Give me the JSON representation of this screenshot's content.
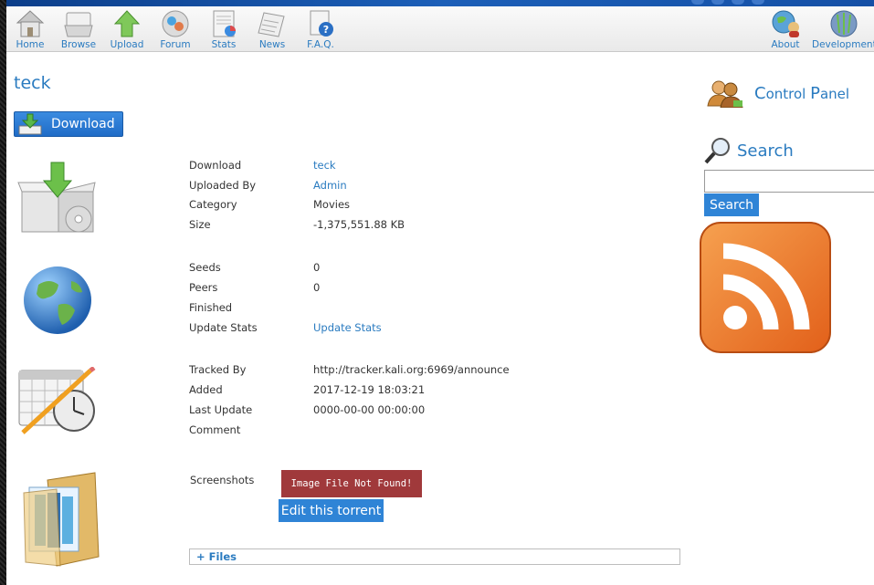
{
  "nav": {
    "left": [
      {
        "label": "Home",
        "icon": "home-icon"
      },
      {
        "label": "Browse",
        "icon": "browse-icon"
      },
      {
        "label": "Upload",
        "icon": "upload-icon"
      },
      {
        "label": "Forum",
        "icon": "forum-icon"
      },
      {
        "label": "Stats",
        "icon": "stats-icon"
      },
      {
        "label": "News",
        "icon": "news-icon"
      },
      {
        "label": "F.A.Q.",
        "icon": "faq-icon"
      }
    ],
    "right": [
      {
        "label": "About",
        "icon": "about-icon"
      },
      {
        "label": "Development",
        "icon": "development-icon"
      }
    ]
  },
  "torrent": {
    "title": "teck",
    "download_button": "Download",
    "info": {
      "download_label": "Download",
      "download_value": "teck",
      "uploaded_by_label": "Uploaded By",
      "uploaded_by_value": "Admin",
      "category_label": "Category",
      "category_value": "Movies",
      "size_label": "Size",
      "size_value": "-1,375,551.88 KB"
    },
    "peers": {
      "seeds_label": "Seeds",
      "seeds_value": "0",
      "peers_label": "Peers",
      "peers_value": "0",
      "finished_label": "Finished",
      "finished_value": "",
      "update_stats_label": "Update Stats",
      "update_stats_value": "Update Stats"
    },
    "tracker": {
      "tracked_by_label": "Tracked By",
      "tracked_by_value": "http://tracker.kali.org:6969/announce",
      "added_label": "Added",
      "added_value": "2017-12-19 18:03:21",
      "last_update_label": "Last Update",
      "last_update_value": "0000-00-00 00:00:00",
      "comment_label": "Comment",
      "comment_value": ""
    },
    "screenshots_label": "Screenshots",
    "image_not_found": "Image File Not Found!",
    "edit_button": "Edit this torrent",
    "files_toggle": "+ Files"
  },
  "sidebar": {
    "control_panel_first": "C",
    "control_panel_rest1": "ontrol ",
    "control_panel_second": "P",
    "control_panel_rest2": "anel",
    "search_title": "Search",
    "search_placeholder": "",
    "search_button": "Search"
  },
  "colors": {
    "link": "#2a7bc0",
    "button_blue": "#2f84d6",
    "error_red": "#a0393b",
    "rss_orange": "#f07f22"
  }
}
